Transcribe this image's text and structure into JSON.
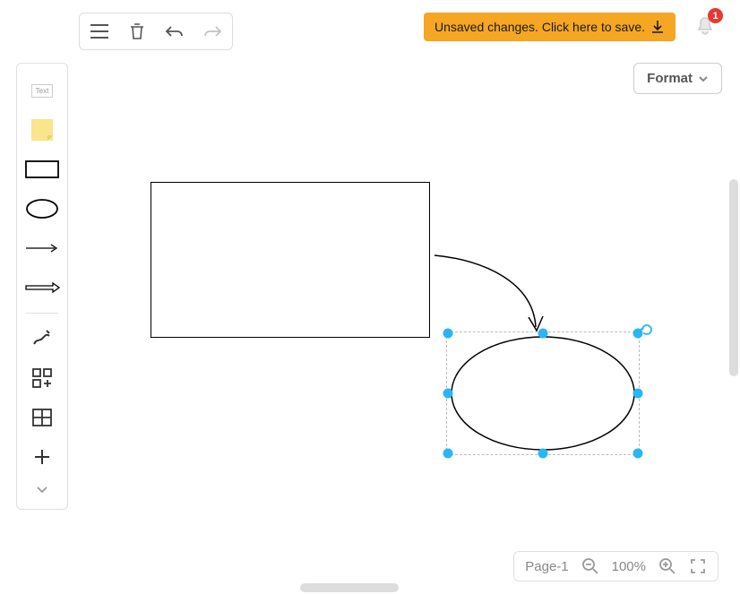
{
  "toolbar": {
    "save_notice": "Unsaved changes. Click here to save.",
    "notification_count": "1"
  },
  "format": {
    "label": "Format"
  },
  "palette": {
    "text_label": "Text"
  },
  "footer": {
    "page_label": "Page-1",
    "zoom_level": "100%"
  },
  "canvas": {
    "shapes": [
      {
        "type": "rectangle"
      },
      {
        "type": "ellipse",
        "selected": true
      }
    ],
    "connectors": [
      {
        "type": "curved-arrow"
      }
    ]
  }
}
